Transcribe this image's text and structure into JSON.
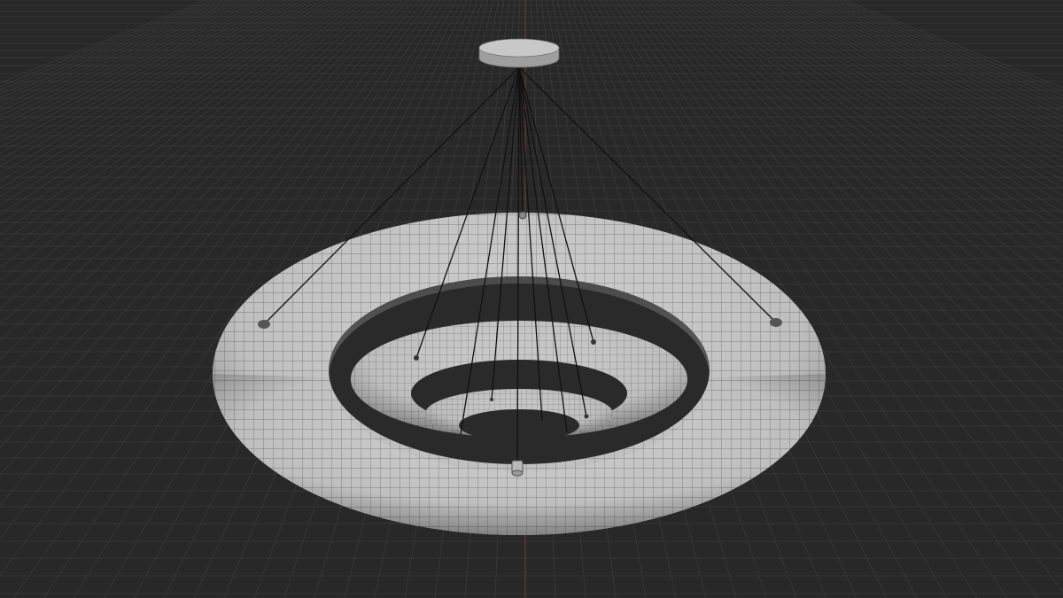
{
  "viewport": {
    "background": "#282828",
    "grid_color": "#3a3a3a",
    "axis_y_color": "#8a2f2f",
    "mesh_fill": "#c9c9c9",
    "wire_color": "#6a6a6a",
    "cable_color": "#111111"
  },
  "scene": {
    "objects": [
      {
        "name": "ceiling-canopy",
        "type": "cylinder"
      },
      {
        "name": "torus-outer",
        "type": "torus",
        "shading": "solid-wireframe"
      },
      {
        "name": "torus-middle",
        "type": "torus",
        "shading": "solid-wireframe"
      },
      {
        "name": "torus-inner",
        "type": "torus",
        "shading": "solid-wireframe"
      },
      {
        "name": "suspension-cables",
        "type": "curve",
        "count": 11
      },
      {
        "name": "light-fixtures",
        "type": "cylinder",
        "count": 11
      }
    ]
  }
}
